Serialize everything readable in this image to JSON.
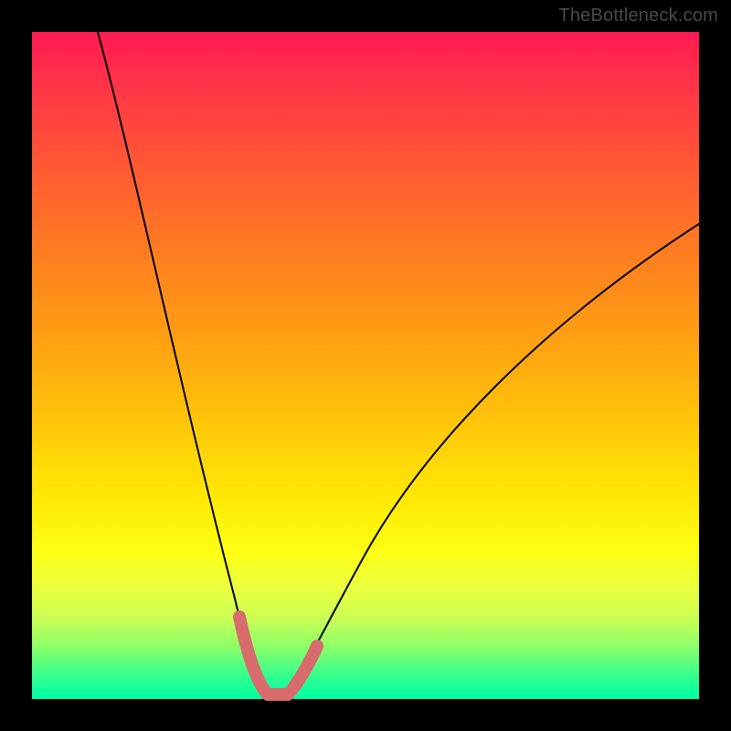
{
  "watermark": {
    "text": "TheBottleneck.com"
  },
  "chart_data": {
    "type": "line",
    "title": "",
    "xlabel": "",
    "ylabel": "",
    "xlim": [
      0,
      100
    ],
    "ylim": [
      0,
      100
    ],
    "gradient_note": "background = vertical gradient red→orange→yellow→green, representing bottleneck severity (top=100, bottom=0)",
    "series": [
      {
        "name": "bottleneck-curve",
        "x": [
          10,
          12,
          14,
          16,
          18,
          20,
          22,
          24,
          26,
          28,
          30,
          32,
          34,
          35,
          36,
          38,
          40,
          44,
          50,
          56,
          62,
          70,
          78,
          86,
          94,
          100
        ],
        "y": [
          100,
          90,
          80,
          70,
          60,
          50,
          42,
          34,
          26,
          18,
          12,
          6,
          2,
          0,
          0,
          2,
          6,
          12,
          20,
          28,
          35,
          44,
          52,
          60,
          66,
          70
        ]
      },
      {
        "name": "optimal-zone-overlay",
        "x": [
          30,
          31,
          32,
          33,
          34,
          35,
          36,
          37,
          38,
          39,
          40
        ],
        "y": [
          10,
          7,
          4,
          2,
          1,
          0,
          0,
          1,
          2,
          4,
          6
        ]
      }
    ]
  }
}
